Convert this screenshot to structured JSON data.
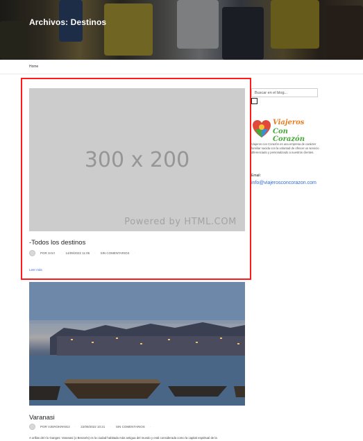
{
  "header": {
    "title": "Archivos: Destinos"
  },
  "breadcrumb": {
    "home": "Home"
  },
  "posts": [
    {
      "image_text": "300 x 200",
      "image_powered": "Powered by HTML.COM",
      "title": "-Todos los destinos",
      "author": "POR XAVI",
      "date": "14/09/2022 11:06",
      "comments": "SIN COMENTARIOS",
      "read_more": "Leer más"
    },
    {
      "title": "Varanasi",
      "author": "POR VJEROKRING2",
      "date": "22/09/2022 10:21",
      "comments": "SIN COMENTARIOS",
      "excerpt": "A orillas del río Ganges: Varanasi (o Benarés) es la ciudad habitada más antigua del mundo y está considerada como la capital espiritual de la"
    }
  ],
  "sidebar": {
    "search_placeholder": "Buscar en el blog...",
    "logo_line1": "Viajeros",
    "logo_line2": "Con Corazón",
    "description": "Viajeros con Corazón es una empresa de carácter familiar nacida con la voluntad de ofrecer un servicio diferenciado y personalizado a nuestros clientes.",
    "email_label": "Email:",
    "email": "info@viajerosconcorazon.com"
  },
  "colors": {
    "highlight": "#ff1a1a",
    "link": "#2f6bd8",
    "logo_orange": "#e87d1e",
    "logo_green": "#4aa83a"
  }
}
